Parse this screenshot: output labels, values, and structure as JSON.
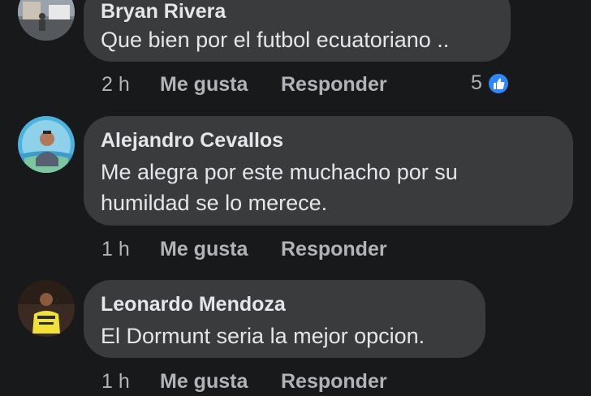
{
  "comments": [
    {
      "author": "Bryan Rivera",
      "text_lines": [
        "Que bien por el futbol ecuatoriano .."
      ],
      "time": "2 h",
      "like_label": "Me gusta",
      "reply_label": "Responder",
      "reaction_count": "5"
    },
    {
      "author": "Alejandro Cevallos",
      "text_lines": [
        "Me alegra por este muchacho por su",
        "humildad se lo merece."
      ],
      "time": "1 h",
      "like_label": "Me gusta",
      "reply_label": "Responder"
    },
    {
      "author": "Leonardo Mendoza",
      "text_lines": [
        "El Dormunt seria la mejor opcion."
      ],
      "time": "1 h",
      "like_label": "Me gusta",
      "reply_label": "Responder"
    }
  ],
  "colors": {
    "background": "#18191a",
    "bubble": "#3a3b3c",
    "text_primary": "#e4e6eb",
    "text_secondary": "#b0b3b8",
    "like_badge": "#2d88ff"
  },
  "icons": {
    "reaction": "thumbs-up-icon"
  }
}
